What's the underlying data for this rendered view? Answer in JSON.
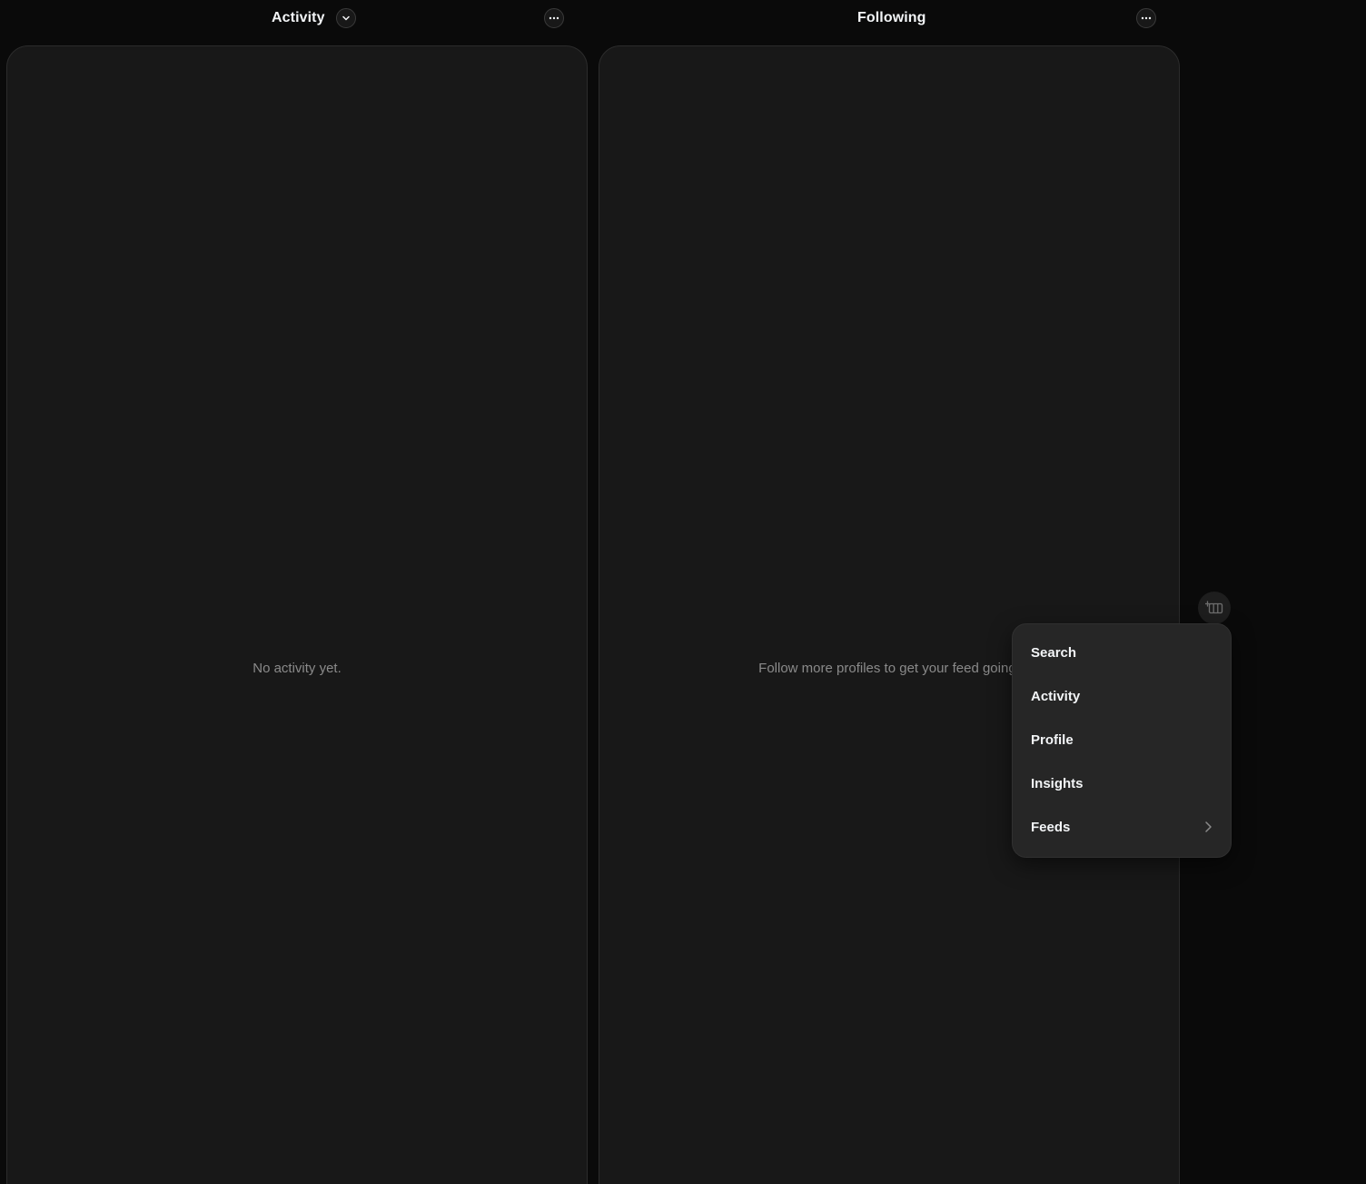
{
  "columns": [
    {
      "title": "Activity",
      "has_dropdown": true,
      "empty_text": "No activity yet."
    },
    {
      "title": "Following",
      "has_dropdown": false,
      "empty_text": "Follow more profiles to get your feed going."
    }
  ],
  "add_column_menu": {
    "items": [
      {
        "label": "Search",
        "submenu": false
      },
      {
        "label": "Activity",
        "submenu": false
      },
      {
        "label": "Profile",
        "submenu": false
      },
      {
        "label": "Insights",
        "submenu": false
      },
      {
        "label": "Feeds",
        "submenu": true
      }
    ]
  },
  "icons": {
    "dropdown": "chevron-down-icon",
    "more": "more-horizontal-icon",
    "add_column": "add-column-icon",
    "submenu": "chevron-right-icon"
  },
  "colors": {
    "background": "#0a0a0a",
    "column_bg": "#181818",
    "menu_bg": "#262626",
    "text_primary": "#f3f5f7",
    "text_secondary": "#8a8a8a"
  }
}
